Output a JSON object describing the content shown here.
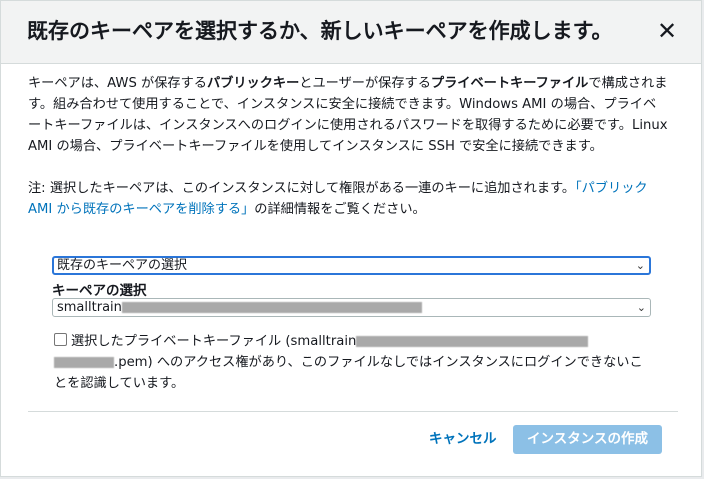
{
  "dialog": {
    "title": "既存のキーペアを選択するか、新しいキーペアを作成します。",
    "close_glyph": "✕"
  },
  "intro": {
    "part1": "キーペアは、AWS が保存する",
    "public_key": "パブリックキー",
    "part2": "とユーザーが保存する",
    "private_key_file": "プライベートキーファイル",
    "part3": "で構成されます。組み合わせて使用することで、インスタンスに安全に接続できます。Windows AMI の場合、プライベートキーファイルは、インスタンスへのログインに使用されるパスワードを取得するために必要です。Linux AMI の場合、プライベートキーファイルを使用してインスタンスに SSH で安全に接続できます。"
  },
  "note": {
    "text": "注: 選択したキーペアは、このインスタンスに対して権限がある一連のキーに追加されます。",
    "link": "「パブリック AMI から既存のキーペアを削除する」",
    "suffix": "の詳細情報をご覧ください。"
  },
  "key_pair_type_select": {
    "value": "既存のキーペアの選択",
    "chevron": "⌄"
  },
  "key_pair_select": {
    "label": "キーペアの選択",
    "value_prefix": "smalltrain",
    "chevron": "⌄"
  },
  "acknowledge": {
    "text_before": "選択したプライベートキーファイル (smalltrain",
    "text_after": ".pem) へのアクセス権があり、このファイルなしではインスタンスにログインできないことを認識しています。"
  },
  "footer": {
    "cancel_label": "キャンセル",
    "create_label": "インスタンスの作成"
  },
  "colors": {
    "link": "#0073bb",
    "primary_disabled": "#8cc0e6",
    "focus_ring": "#2b76d9",
    "header_bg": "#f2f3f3"
  }
}
